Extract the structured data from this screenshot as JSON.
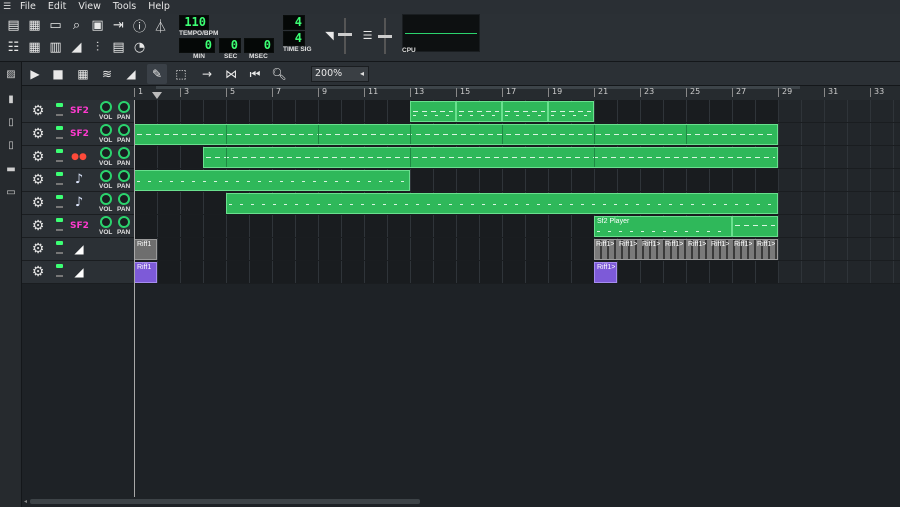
{
  "menu": {
    "items": [
      "File",
      "Edit",
      "View",
      "Tools",
      "Help"
    ]
  },
  "toolbar": {
    "tempo_value": "110",
    "tempo_label": "TEMPO/BPM",
    "min_value": "0",
    "min_label": "MIN",
    "sec_value": "0",
    "sec_label": "SEC",
    "msec_value": "0",
    "msec_label": "MSEC",
    "timesig_top": "4",
    "timesig_bottom": "4",
    "timesig_label": "TIME SIG",
    "cpu_label": "CPU"
  },
  "song_editor": {
    "zoom": "200%",
    "bar_numbers": [
      "1",
      "3",
      "5",
      "7",
      "9",
      "11",
      "13",
      "15",
      "17",
      "19",
      "21",
      "23",
      "25",
      "27",
      "29",
      "31",
      "33"
    ]
  },
  "tracks": [
    {
      "instrument": "sf2",
      "vol_label": "VOL",
      "pan_label": "PAN"
    },
    {
      "instrument": "sf2",
      "vol_label": "VOL",
      "pan_label": "PAN"
    },
    {
      "instrument": "kicker",
      "vol_label": "VOL",
      "pan_label": "PAN"
    },
    {
      "instrument": "note",
      "vol_label": "VOL",
      "pan_label": "PAN"
    },
    {
      "instrument": "note",
      "vol_label": "VOL",
      "pan_label": "PAN"
    },
    {
      "instrument": "sf2",
      "vol_label": "VOL",
      "pan_label": "PAN"
    },
    {
      "instrument": "automation"
    },
    {
      "instrument": "automation"
    }
  ],
  "clips": {
    "sf2_player_label": "Sf2 Player",
    "riff_label": "Riff1",
    "riff_arrow_label": "Riff1>"
  },
  "colors": {
    "lcd_green": "#3cff74",
    "clip_green": "#2fb85a",
    "riff_purple": "#7d5ad8"
  }
}
